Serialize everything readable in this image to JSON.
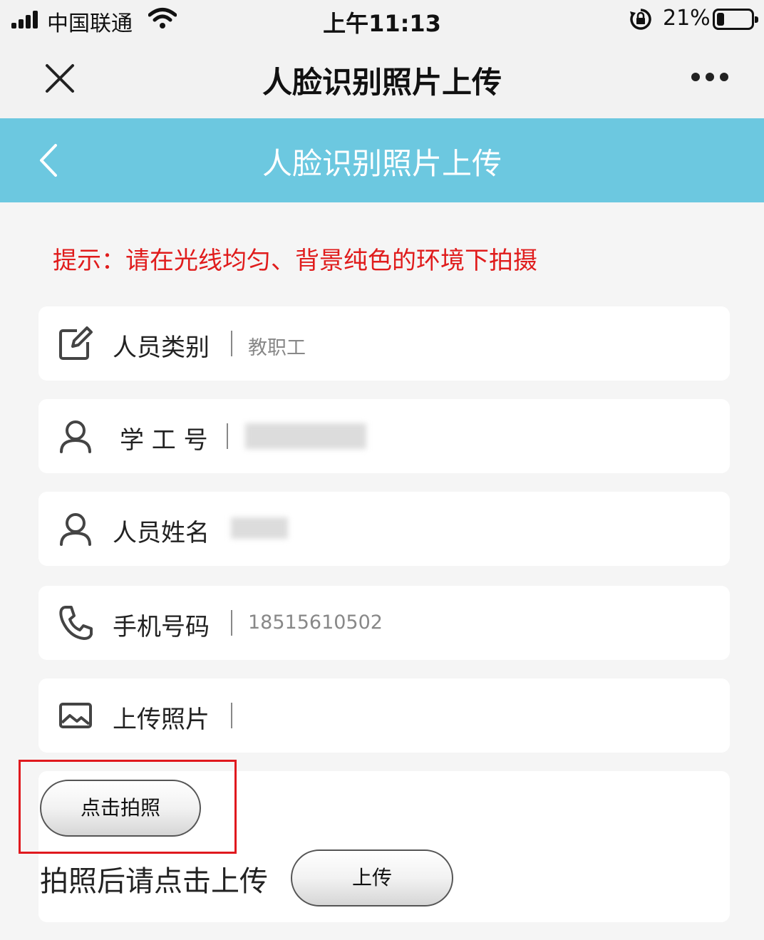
{
  "status_bar": {
    "carrier": "中国联通",
    "time": "上午11:13",
    "battery_percent": "21%",
    "battery_level": 0.21
  },
  "nav_bar": {
    "title": "人脸识别照片上传",
    "close_icon": "close-icon",
    "more_icon": "more-dots-icon"
  },
  "page_header": {
    "title": "人脸识别照片上传",
    "back_icon": "chevron-left-icon",
    "background_color": "#6cc8e0"
  },
  "tip": "提示：请在光线均匀、背景纯色的环境下拍摄",
  "form": {
    "person_type": {
      "label": "人员类别",
      "value": "教职工",
      "icon": "edit-icon"
    },
    "staff_id": {
      "label": "学 工 号",
      "value": "",
      "icon": "user-icon"
    },
    "name": {
      "label": "人员姓名",
      "value": "",
      "icon": "user-icon"
    },
    "phone": {
      "label": "手机号码",
      "value": "18515610502",
      "icon": "phone-icon"
    },
    "upload_photo": {
      "label": "上传照片",
      "value": "",
      "icon": "image-icon"
    }
  },
  "actions": {
    "take_photo_label": "点击拍照",
    "after_text": "拍照后请点击上传",
    "upload_label": "上传"
  },
  "colors": {
    "tip": "#e01c1c",
    "highlight": "#e0191e"
  }
}
